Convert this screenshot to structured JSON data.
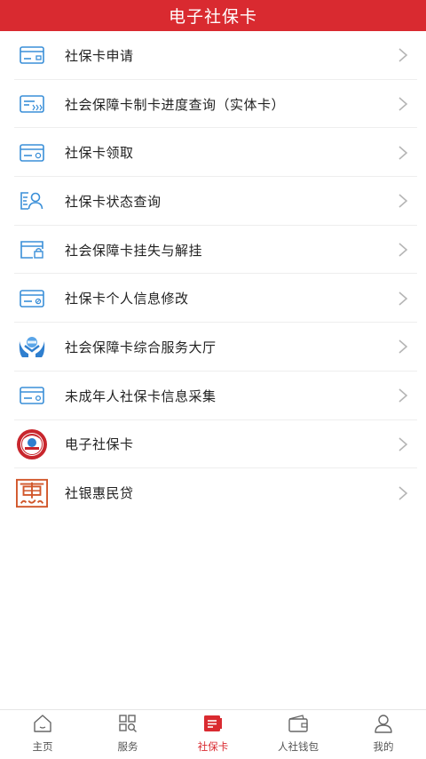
{
  "header": {
    "title": "电子社保卡"
  },
  "menu": [
    {
      "label": "社保卡申请",
      "icon": "card-icon"
    },
    {
      "label": "社会保障卡制卡进度查询（实体卡）",
      "icon": "card-progress-icon"
    },
    {
      "label": "社保卡领取",
      "icon": "card-receive-icon"
    },
    {
      "label": "社保卡状态查询",
      "icon": "person-query-icon"
    },
    {
      "label": "社会保障卡挂失与解挂",
      "icon": "card-lock-icon"
    },
    {
      "label": "社保卡个人信息修改",
      "icon": "card-edit-icon"
    },
    {
      "label": "社会保障卡综合服务大厅",
      "icon": "hands-service-icon"
    },
    {
      "label": "未成年人社保卡信息采集",
      "icon": "card-collect-icon"
    },
    {
      "label": "电子社保卡",
      "icon": "ecard-seal-icon"
    },
    {
      "label": "社银惠民贷",
      "icon": "hui-logo-icon"
    }
  ],
  "tabs": [
    {
      "label": "主页",
      "icon": "home-icon",
      "active": false
    },
    {
      "label": "服务",
      "icon": "grid-search-icon",
      "active": false
    },
    {
      "label": "社保卡",
      "icon": "card-tab-icon",
      "active": true
    },
    {
      "label": "人社钱包",
      "icon": "wallet-icon",
      "active": false
    },
    {
      "label": "我的",
      "icon": "profile-icon",
      "active": false
    }
  ],
  "colors": {
    "brand": "#d92a30",
    "icon_blue": "#3a8fd8"
  }
}
